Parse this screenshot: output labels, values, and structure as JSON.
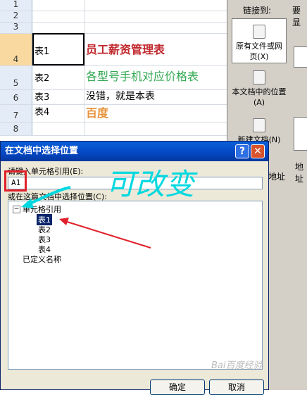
{
  "sheet": {
    "rows": [
      {
        "num": "1",
        "a": "",
        "b": ""
      },
      {
        "num": "2",
        "a": "",
        "b": ""
      },
      {
        "num": "3",
        "a": "",
        "b": ""
      },
      {
        "num": "4",
        "a": "表1",
        "b": "员工薪资管理表",
        "b_color": "#c0282d"
      },
      {
        "num": "5",
        "a": "表2",
        "b": "各型号手机对应价格表",
        "b_color": "#34a853"
      },
      {
        "num": "6",
        "a": "表3",
        "b": "没错，就是本表",
        "b_color": "#000000"
      },
      {
        "num": "7",
        "a": "表4",
        "b": "百度",
        "b_color": "#e8923a"
      },
      {
        "num": "8",
        "a": "",
        "b": ""
      }
    ]
  },
  "link_panel": {
    "link_to_label": "链接到:",
    "display_label": "要显",
    "existing_file": "原有文件或网页(X)",
    "this_document": "本文档中的位置(A)",
    "new_document": "新建文档(N)",
    "email": "地址",
    "side_label": "地址"
  },
  "dialog": {
    "title": "在文档中选择位置",
    "help_glyph": "?",
    "close_glyph": "✕",
    "ref_label": "请键入单元格引用(E):",
    "ref_value": "A1",
    "select_label": "或在这篇文档中选择位置(C):",
    "tree": {
      "root": "单元格引用",
      "root_expander": "−",
      "children": [
        "表1",
        "表2",
        "表3",
        "表4"
      ],
      "defined_names": "已定义名称"
    },
    "ok": "确定",
    "cancel": "取消"
  },
  "annotation": {
    "handwriting": "可改变",
    "color": "#00d8e0",
    "arrow_color": "#e0202a"
  },
  "watermark": "Bai百度经验"
}
